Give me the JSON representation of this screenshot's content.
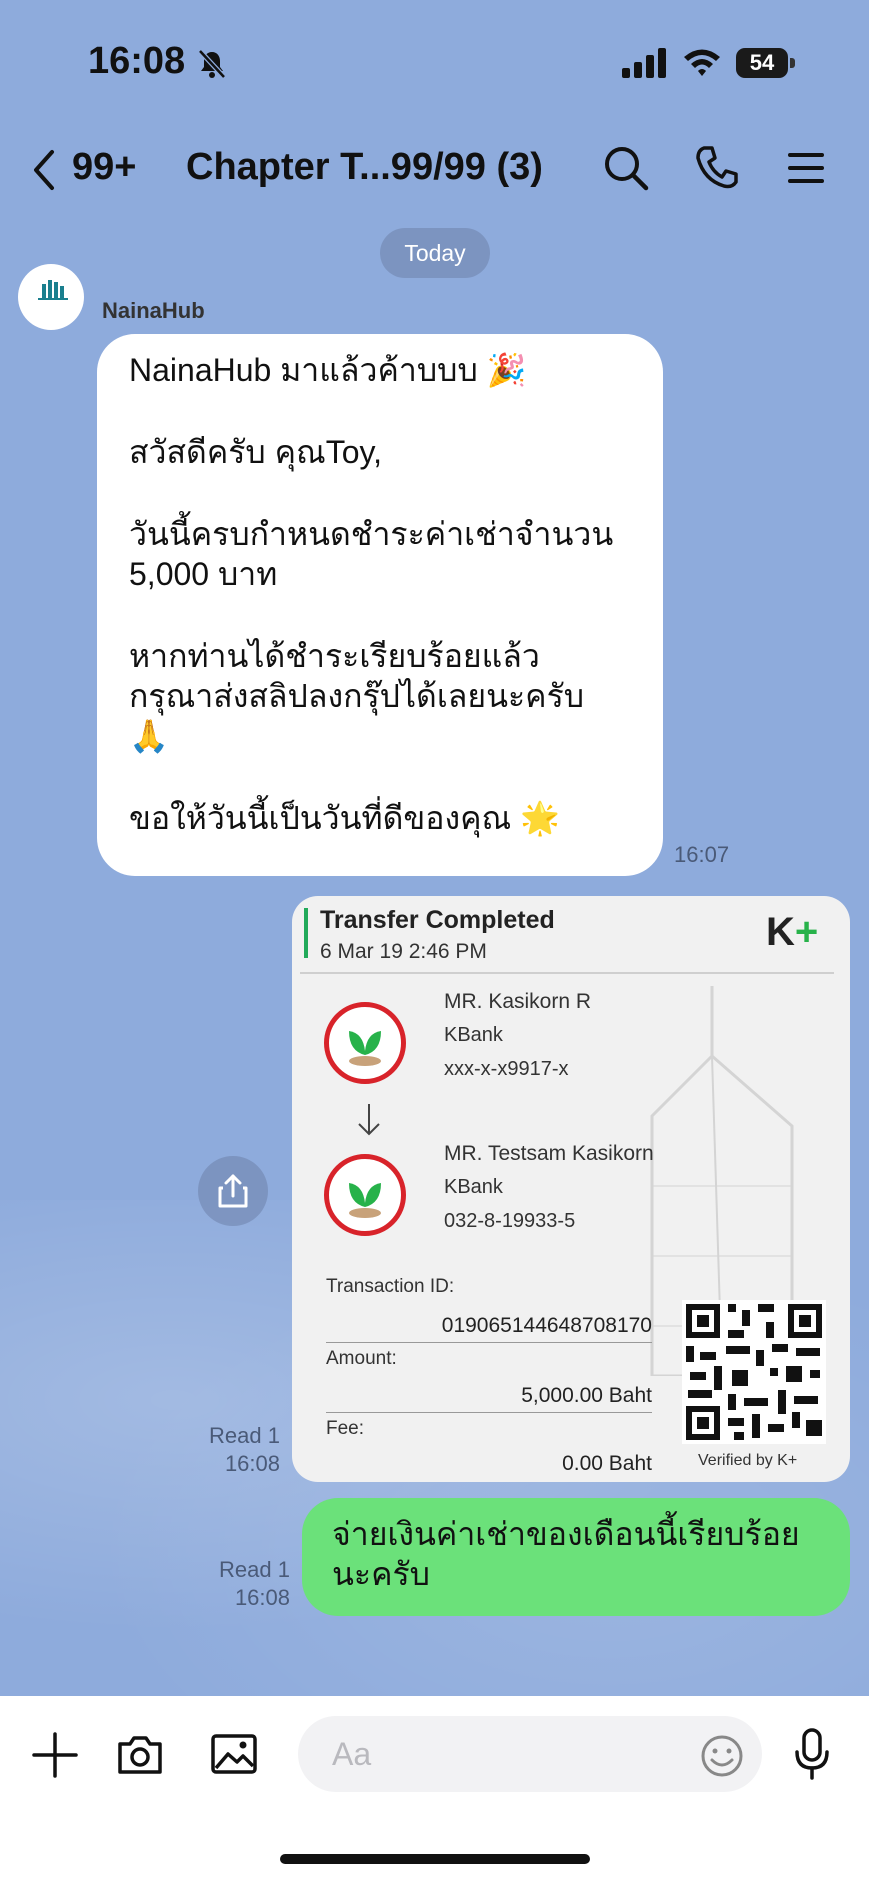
{
  "status": {
    "time": "16:08",
    "battery": "54",
    "battery_level": 0.54
  },
  "header": {
    "back_count": "99+",
    "title": "Chapter T...99/99 (3)"
  },
  "date_divider": "Today",
  "messages": {
    "incoming": {
      "sender": "NainaHub",
      "avatar_text": "NainaHub",
      "lines": [
        "NainaHub มาแล้วค้าบบบ 🎉",
        "สวัสดีครับ คุณToy,",
        "วันนี้ครบกำหนดชำระค่าเช่าจำนวน",
        "5,000 บาท",
        "หากท่านได้ชำระเรียบร้อยแล้ว",
        "กรุณาส่งสลิปลงกรุ๊ปได้เลยนะครับ",
        "🙏",
        "ขอให้วันนี้เป็นวันที่ดีของคุณ 🌟"
      ],
      "time": "16:07"
    },
    "slip": {
      "title": "Transfer Completed",
      "date": "6 Mar 19  2:46 PM",
      "brand": "K",
      "brand_plus": "+",
      "from_name": "MR. Kasikorn R",
      "from_bank": "KBank",
      "from_account": "xxx-x-x9917-x",
      "to_name": "MR. Testsam Kasikorn",
      "to_bank": "KBank",
      "to_account": "032-8-19933-5",
      "transaction_label": "Transaction ID:",
      "transaction_id": "019065144648708170",
      "amount_label": "Amount:",
      "amount": "5,000.00 Baht",
      "fee_label": "Fee:",
      "fee": "0.00 Baht",
      "verified": "Verified by K+",
      "read_status": "Read 1",
      "time": "16:08"
    },
    "outgoing": {
      "lines": [
        "จ่ายเงินค่าเช่าของเดือนนี้เรียบร้อย",
        "นะครับ"
      ],
      "read_status": "Read 1",
      "time": "16:08"
    }
  },
  "input": {
    "placeholder": "Aa"
  },
  "icons": {
    "back": "chevron-left-icon",
    "search": "search-icon",
    "call": "phone-icon",
    "menu": "hamburger-menu-icon",
    "share": "share-icon",
    "plus": "plus-icon",
    "camera": "camera-icon",
    "image": "image-icon",
    "emoji": "emoji-icon",
    "mic": "microphone-icon"
  },
  "colors": {
    "background": "#8eabdc",
    "incoming_bubble": "#ffffff",
    "outgoing_bubble": "#6be17a",
    "kbank_red": "#d8232a",
    "kbank_green": "#27b24a"
  }
}
